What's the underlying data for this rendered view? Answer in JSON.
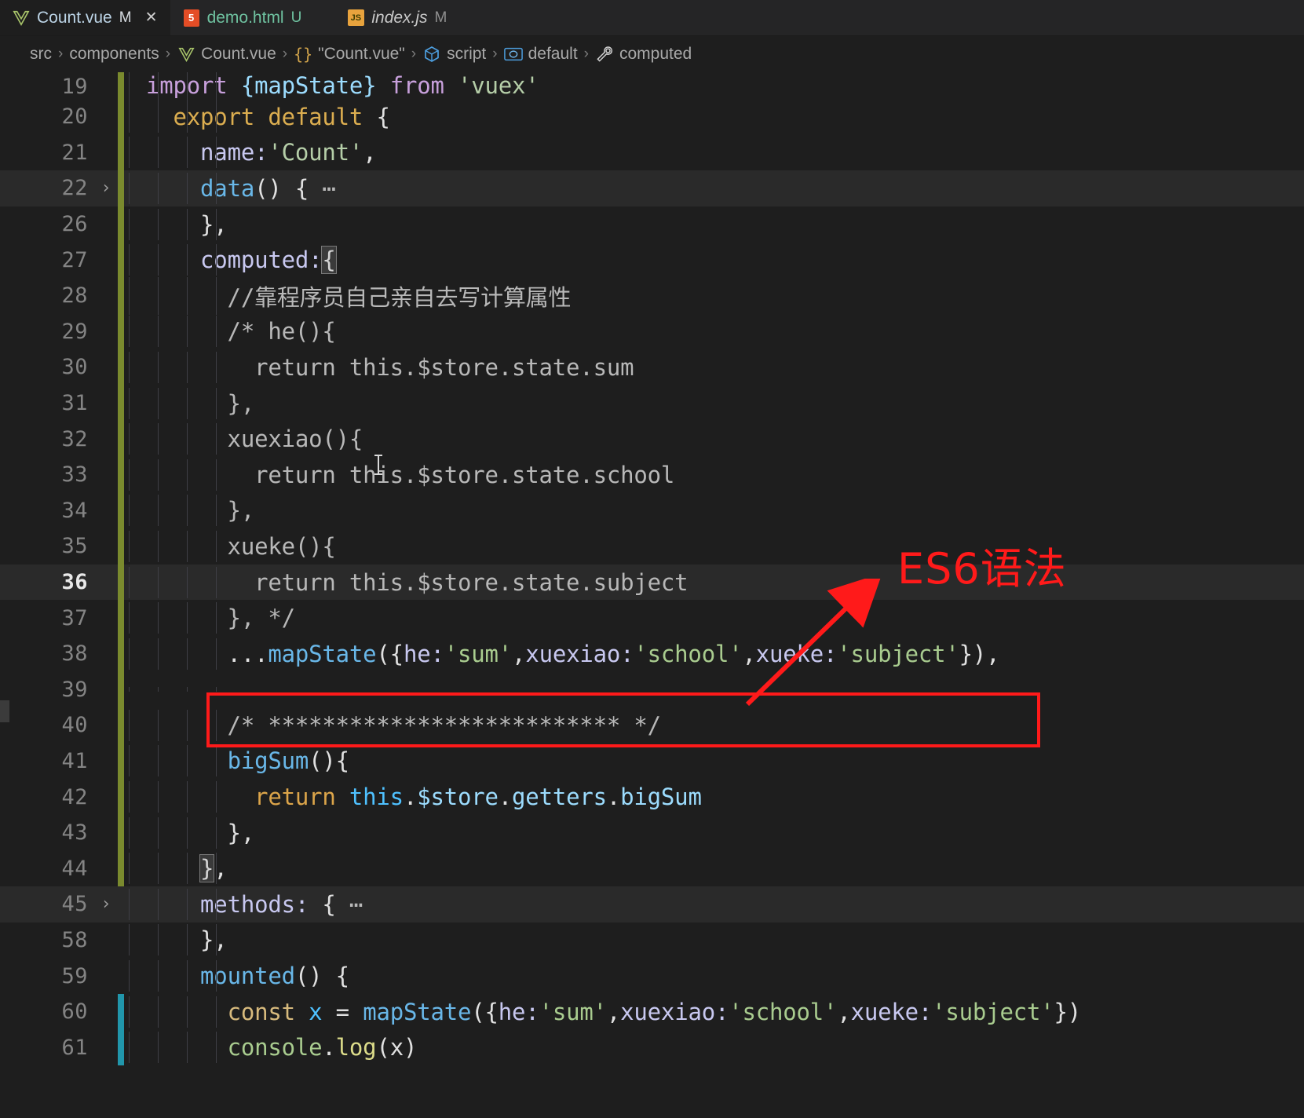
{
  "window": {
    "app": "vscode",
    "theme_bg": "#1e1e1e",
    "accent_red": "#ff1a1a"
  },
  "tabs": [
    {
      "label": "Count.vue",
      "state": "M",
      "icon": "vue-file-icon",
      "active": true,
      "closable": true,
      "close_glyph": "✕"
    },
    {
      "label": "demo.html",
      "state": "U",
      "icon": "html5-file-icon",
      "active": false,
      "closable": false,
      "badge_text": "5"
    },
    {
      "label": "index.js",
      "state": "M",
      "icon": "js-file-icon",
      "active": false,
      "closable": false,
      "badge_text": "JS"
    }
  ],
  "breadcrumb": {
    "separator": "›",
    "segments": [
      {
        "label": "src",
        "icon": null
      },
      {
        "label": "components",
        "icon": null
      },
      {
        "label": "Count.vue",
        "icon": "vue-file-icon"
      },
      {
        "label": "\"Count.vue\"",
        "icon": "braces-symbol-icon",
        "icon_text": "{}"
      },
      {
        "label": "script",
        "icon": "cube-symbol-icon"
      },
      {
        "label": "default",
        "icon": "object-symbol-icon"
      },
      {
        "label": "computed",
        "icon": "wrench-property-icon"
      }
    ]
  },
  "editor": {
    "current_line": 36,
    "lines": [
      {
        "num": "19",
        "fold": "",
        "bar": "green",
        "hl": false,
        "clipped": true,
        "tokens": [
          {
            "t": "import ",
            "c": "purple"
          },
          {
            "t": "{mapState} ",
            "c": "prop"
          },
          {
            "t": "from ",
            "c": "purple"
          },
          {
            "t": "'vuex'",
            "c": "str"
          }
        ]
      },
      {
        "num": "20",
        "fold": "",
        "bar": "green",
        "hl": false,
        "tokens": [
          {
            "t": "  ",
            "c": "white"
          },
          {
            "t": "export default ",
            "c": "orange"
          },
          {
            "t": "{",
            "c": "white"
          }
        ]
      },
      {
        "num": "21",
        "fold": "",
        "bar": "green",
        "hl": false,
        "tokens": [
          {
            "t": "    ",
            "c": "white"
          },
          {
            "t": "name:",
            "c": "propv"
          },
          {
            "t": "'Count'",
            "c": "str"
          },
          {
            "t": ",",
            "c": "white"
          }
        ]
      },
      {
        "num": "22",
        "fold": "›",
        "bar": "green",
        "hl": true,
        "tokens": [
          {
            "t": "    ",
            "c": "white"
          },
          {
            "t": "data",
            "c": "fnblue"
          },
          {
            "t": "() { ",
            "c": "white"
          },
          {
            "t": "⋯",
            "c": "cmt"
          }
        ]
      },
      {
        "num": "26",
        "fold": "",
        "bar": "green",
        "hl": false,
        "tokens": [
          {
            "t": "    },",
            "c": "white"
          }
        ]
      },
      {
        "num": "27",
        "fold": "",
        "bar": "green",
        "hl": false,
        "tokens": [
          {
            "t": "    ",
            "c": "white"
          },
          {
            "t": "computed:",
            "c": "propv"
          },
          {
            "t": "{",
            "c": "bmatch"
          }
        ]
      },
      {
        "num": "28",
        "fold": "",
        "bar": "green",
        "hl": false,
        "tokens": [
          {
            "t": "      //靠程序员自己亲自去写计算属性",
            "c": "cmt"
          }
        ]
      },
      {
        "num": "29",
        "fold": "",
        "bar": "green",
        "hl": false,
        "tokens": [
          {
            "t": "      /* he(){",
            "c": "cmt"
          }
        ]
      },
      {
        "num": "30",
        "fold": "",
        "bar": "green",
        "hl": false,
        "tokens": [
          {
            "t": "        return this.$store.state.sum",
            "c": "cmt"
          }
        ]
      },
      {
        "num": "31",
        "fold": "",
        "bar": "green",
        "hl": false,
        "tokens": [
          {
            "t": "      },",
            "c": "cmt"
          }
        ]
      },
      {
        "num": "32",
        "fold": "",
        "bar": "green",
        "hl": false,
        "tokens": [
          {
            "t": "      xuexiao(){",
            "c": "cmt"
          }
        ]
      },
      {
        "num": "33",
        "fold": "",
        "bar": "green",
        "hl": false,
        "tokens": [
          {
            "t": "        return this.$store.state.school",
            "c": "cmt"
          }
        ]
      },
      {
        "num": "34",
        "fold": "",
        "bar": "green",
        "hl": false,
        "tokens": [
          {
            "t": "      },",
            "c": "cmt"
          }
        ]
      },
      {
        "num": "35",
        "fold": "",
        "bar": "green",
        "hl": false,
        "tokens": [
          {
            "t": "      xueke(){",
            "c": "cmt"
          }
        ]
      },
      {
        "num": "36",
        "fold": "",
        "bar": "green",
        "hl": true,
        "current": true,
        "tokens": [
          {
            "t": "        return this.$store.state.subject",
            "c": "cmt"
          }
        ]
      },
      {
        "num": "37",
        "fold": "",
        "bar": "green",
        "hl": false,
        "tokens": [
          {
            "t": "      }, */",
            "c": "cmt"
          }
        ]
      },
      {
        "num": "38",
        "fold": "",
        "bar": "green",
        "hl": false,
        "tokens": [
          {
            "t": "      ...",
            "c": "white"
          },
          {
            "t": "mapState",
            "c": "fnblue"
          },
          {
            "t": "({",
            "c": "white"
          },
          {
            "t": "he:",
            "c": "propv"
          },
          {
            "t": "'sum'",
            "c": "strg"
          },
          {
            "t": ",",
            "c": "white"
          },
          {
            "t": "xuexiao:",
            "c": "propv"
          },
          {
            "t": "'school'",
            "c": "strg"
          },
          {
            "t": ",",
            "c": "white"
          },
          {
            "t": "xueke:",
            "c": "propv"
          },
          {
            "t": "'subject'",
            "c": "strg"
          },
          {
            "t": "}),",
            "c": "white"
          }
        ]
      },
      {
        "num": "39",
        "fold": "",
        "bar": "green",
        "hl": false,
        "tokens": []
      },
      {
        "num": "40",
        "fold": "",
        "bar": "green",
        "hl": false,
        "tokens": [
          {
            "t": "      /* ************************** */",
            "c": "cmt"
          }
        ]
      },
      {
        "num": "41",
        "fold": "",
        "bar": "green",
        "hl": false,
        "tokens": [
          {
            "t": "      ",
            "c": "white"
          },
          {
            "t": "bigSum",
            "c": "fnblue"
          },
          {
            "t": "(){",
            "c": "white"
          }
        ]
      },
      {
        "num": "42",
        "fold": "",
        "bar": "green",
        "hl": false,
        "tokens": [
          {
            "t": "        ",
            "c": "white"
          },
          {
            "t": "return",
            "c": "ret"
          },
          {
            "t": " this",
            "c": "cyan"
          },
          {
            "t": ".",
            "c": "white"
          },
          {
            "t": "$store",
            "c": "prop"
          },
          {
            "t": ".",
            "c": "white"
          },
          {
            "t": "getters",
            "c": "prop"
          },
          {
            "t": ".",
            "c": "white"
          },
          {
            "t": "bigSum",
            "c": "prop"
          }
        ]
      },
      {
        "num": "43",
        "fold": "",
        "bar": "green",
        "hl": false,
        "tokens": [
          {
            "t": "      },",
            "c": "white"
          }
        ]
      },
      {
        "num": "44",
        "fold": "",
        "bar": "green",
        "hl": false,
        "tokens": [
          {
            "t": "    ",
            "c": "white"
          },
          {
            "t": "}",
            "c": "bmatch"
          },
          {
            "t": ",",
            "c": "white"
          }
        ]
      },
      {
        "num": "45",
        "fold": "›",
        "bar": "none",
        "hl": true,
        "tokens": [
          {
            "t": "    ",
            "c": "white"
          },
          {
            "t": "methods:",
            "c": "propv"
          },
          {
            "t": " { ",
            "c": "white"
          },
          {
            "t": "⋯",
            "c": "cmt"
          }
        ]
      },
      {
        "num": "58",
        "fold": "",
        "bar": "none",
        "hl": false,
        "tokens": [
          {
            "t": "    },",
            "c": "white"
          }
        ]
      },
      {
        "num": "59",
        "fold": "",
        "bar": "none",
        "hl": false,
        "tokens": [
          {
            "t": "    ",
            "c": "white"
          },
          {
            "t": "mounted",
            "c": "fnblue"
          },
          {
            "t": "() {",
            "c": "white"
          }
        ]
      },
      {
        "num": "60",
        "fold": "",
        "bar": "blue",
        "hl": false,
        "tokens": [
          {
            "t": "      ",
            "c": "white"
          },
          {
            "t": "const",
            "c": "consty"
          },
          {
            "t": " x ",
            "c": "cyan"
          },
          {
            "t": "= ",
            "c": "white"
          },
          {
            "t": "mapState",
            "c": "fnblue"
          },
          {
            "t": "({",
            "c": "white"
          },
          {
            "t": "he:",
            "c": "propv"
          },
          {
            "t": "'sum'",
            "c": "strg"
          },
          {
            "t": ",",
            "c": "white"
          },
          {
            "t": "xuexiao:",
            "c": "propv"
          },
          {
            "t": "'school'",
            "c": "strg"
          },
          {
            "t": ",",
            "c": "white"
          },
          {
            "t": "xueke:",
            "c": "propv"
          },
          {
            "t": "'subject'",
            "c": "strg"
          },
          {
            "t": "})",
            "c": "white"
          }
        ]
      },
      {
        "num": "61",
        "fold": "",
        "bar": "blue",
        "hl": false,
        "tokens": [
          {
            "t": "      ",
            "c": "white"
          },
          {
            "t": "console",
            "c": "strg"
          },
          {
            "t": ".",
            "c": "white"
          },
          {
            "t": "log",
            "c": "yellow"
          },
          {
            "t": "(x)",
            "c": "white"
          }
        ]
      }
    ]
  },
  "annotation": {
    "label": "ES6语法",
    "color": "#ff1a1a",
    "box_target_line": "38",
    "arrow": "points-up-right-from-line-38-to-label"
  }
}
